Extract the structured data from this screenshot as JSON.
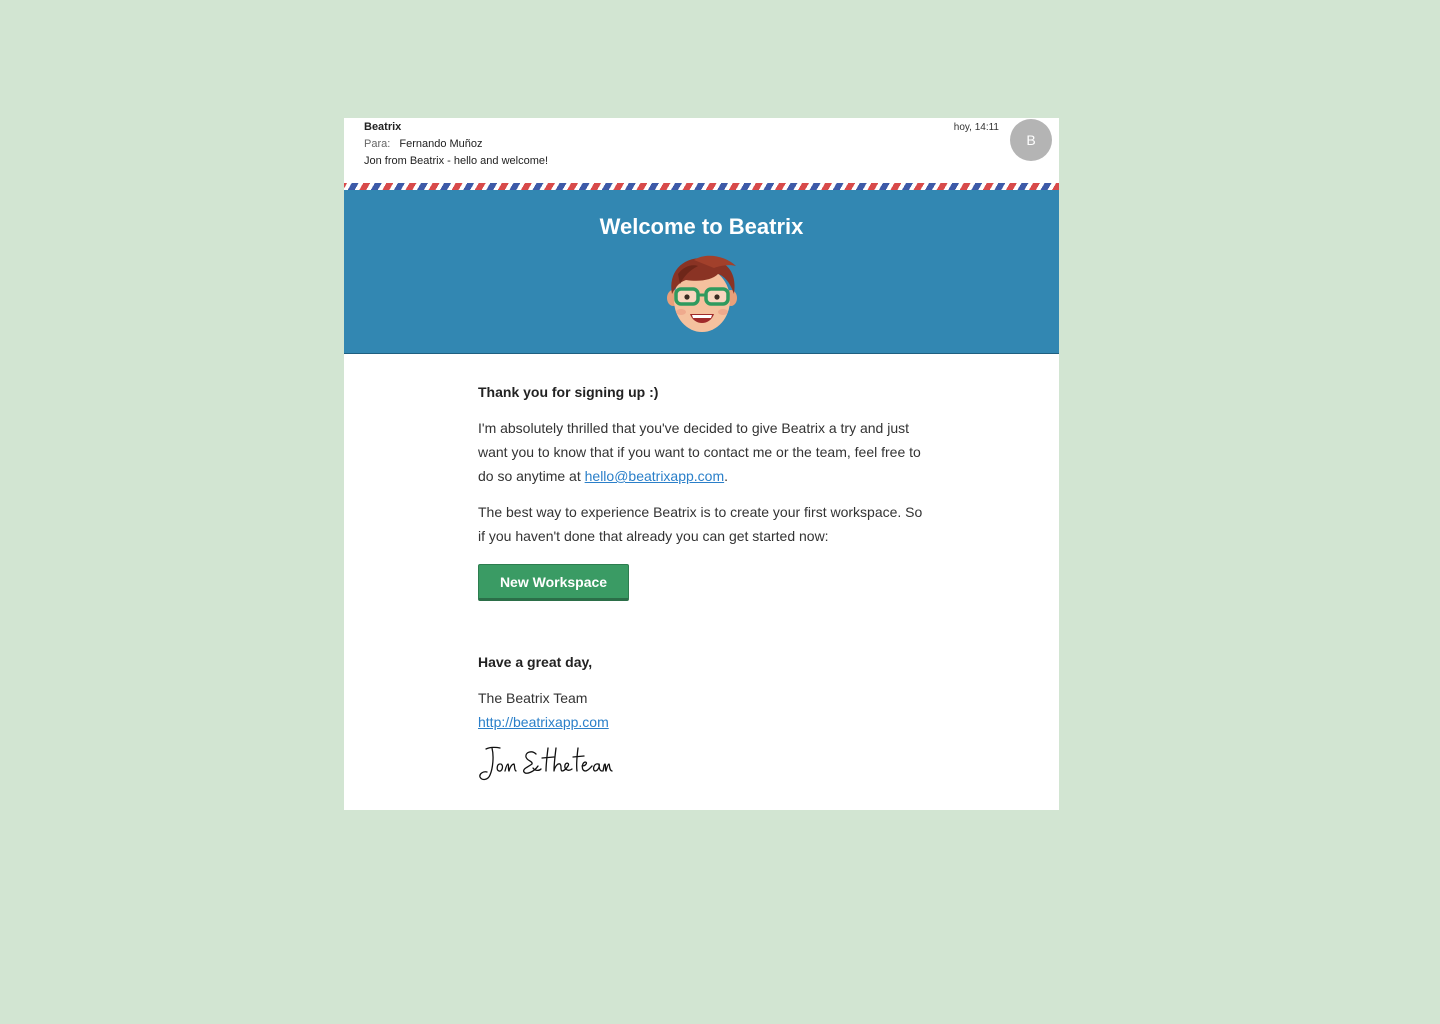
{
  "header": {
    "sender": "Beatrix",
    "to_label": "Para:",
    "to_value": "Fernando Muñoz",
    "subject": "Jon from Beatrix - hello and welcome!",
    "time": "hoy, 14:11",
    "avatar_initial": "B"
  },
  "banner": {
    "title": "Welcome to Beatrix",
    "mascot_icon": "mascot-face-icon"
  },
  "body": {
    "greeting": "Thank you for signing up :)",
    "para1_text": "I'm absolutely thrilled that you've decided to give Beatrix a try and just want you to know that if you want to contact me or the team, feel free to do so anytime at ",
    "para1_email": "hello@beatrixapp.com",
    "para1_end": ".",
    "para2": "The best way to experience Beatrix is to create your first workspace. So if you haven't done that already you can get started now:",
    "cta_label": "New Workspace"
  },
  "closing": {
    "farewell": "Have a great day,",
    "team": "The Beatrix Team",
    "url": "http://beatrixapp.com",
    "signature": "Jon & the team"
  },
  "colors": {
    "background": "#d2e5d2",
    "banner": "#3287b2",
    "cta": "#3a9b64",
    "link": "#2a7fc9",
    "airmail_red": "#d84a4a",
    "airmail_blue": "#3d5aa8"
  }
}
